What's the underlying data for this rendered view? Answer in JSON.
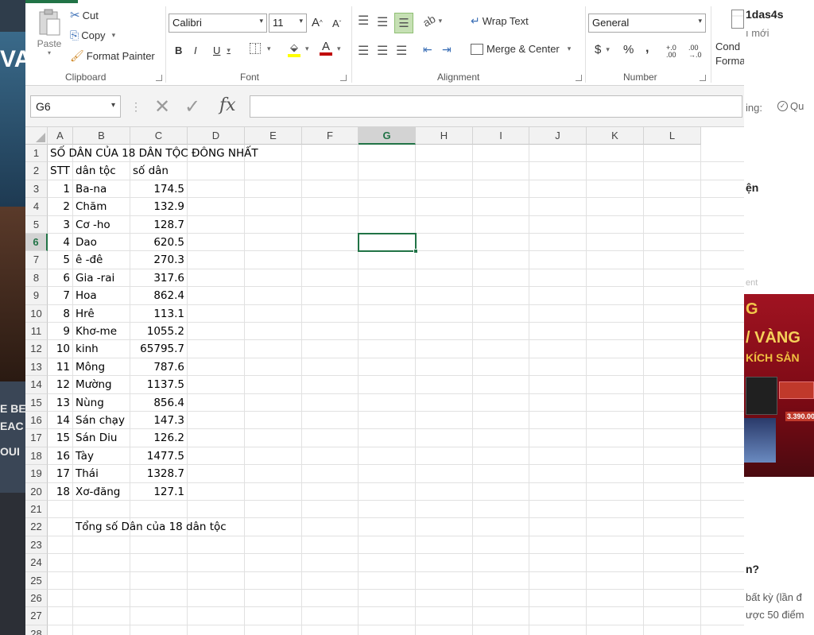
{
  "background_left": {
    "text": "VA",
    "text2": "E BE",
    "text3": "EAC",
    "text4": "OUI"
  },
  "background_right": {
    "user": "1das4s",
    "sub": "ı mới",
    "filter_label": "ing:",
    "filter_value": "Qu",
    "heading1": "ện",
    "banner_g": "G",
    "banner_title": "/ VÀNG",
    "banner_sub": "KÍCH SẢN",
    "banner_price": "3.390.000",
    "question": "n?",
    "line1": "bất kỳ (lần đ",
    "line2": "ược 50 điểm"
  },
  "ribbon": {
    "clipboard": {
      "paste": "Paste",
      "cut": "Cut",
      "copy": "Copy",
      "format_painter": "Format Painter",
      "label": "Clipboard"
    },
    "font": {
      "name": "Calibri",
      "size": "11",
      "grow": "A",
      "shrink": "A",
      "bold": "B",
      "italic": "I",
      "underline": "U",
      "font_color_letter": "A",
      "label": "Font"
    },
    "alignment": {
      "wrap_text": "Wrap Text",
      "merge_center": "Merge & Center",
      "label": "Alignment"
    },
    "number": {
      "format": "General",
      "currency": "$",
      "percent": "%",
      "comma": ",",
      "inc_decimal": "+.0 .00",
      "dec_decimal": ".00 →.0",
      "label": "Number"
    },
    "styles": {
      "cond": "Cond",
      "format": "Forma"
    },
    "colors": {
      "accent": "#217346",
      "font_red": "#c00000",
      "highlight_yellow": "#ffff00"
    }
  },
  "formula_bar": {
    "name_box": "G6",
    "fx": "fx",
    "value": ""
  },
  "grid": {
    "selected_cell": "G6",
    "columns": [
      "A",
      "B",
      "C",
      "D",
      "E",
      "F",
      "G",
      "H",
      "I",
      "J",
      "K",
      "L"
    ],
    "rows": [
      "1",
      "2",
      "3",
      "4",
      "5",
      "6",
      "7",
      "8",
      "9",
      "10",
      "11",
      "12",
      "13",
      "14",
      "15",
      "16",
      "17",
      "18",
      "19",
      "20",
      "21",
      "22",
      "23",
      "24",
      "25",
      "26",
      "27",
      "28"
    ],
    "title": "SỐ DÂN CỦA 18 DÂN TỘC ĐÔNG NHẤT",
    "headers": [
      "STT",
      "dân tộc",
      "số dân"
    ],
    "data": [
      [
        "1",
        "Ba-na",
        "174.5"
      ],
      [
        "2",
        "Chăm",
        "132.9"
      ],
      [
        "3",
        "Cơ -ho",
        "128.7"
      ],
      [
        "4",
        "Dao",
        "620.5"
      ],
      [
        "5",
        "ê -đê",
        "270.3"
      ],
      [
        "6",
        "Gia -rai",
        "317.6"
      ],
      [
        "7",
        "Hoa",
        "862.4"
      ],
      [
        "8",
        "Hrê",
        "113.1"
      ],
      [
        "9",
        "Khơ-me",
        "1055.2"
      ],
      [
        "10",
        "kinh",
        "65795.7"
      ],
      [
        "11",
        "Mông",
        "787.6"
      ],
      [
        "12",
        "Mường",
        "1137.5"
      ],
      [
        "13",
        "Nùng",
        "856.4"
      ],
      [
        "14",
        "Sán chạy",
        "147.3"
      ],
      [
        "15",
        "Sán Diu",
        "126.2"
      ],
      [
        "16",
        "Tày",
        "1477.5"
      ],
      [
        "17",
        "Thái",
        "1328.7"
      ],
      [
        "18",
        "Xơ-đăng",
        "127.1"
      ]
    ],
    "total_label": "Tổng số Dân của 18 dân tộc"
  }
}
